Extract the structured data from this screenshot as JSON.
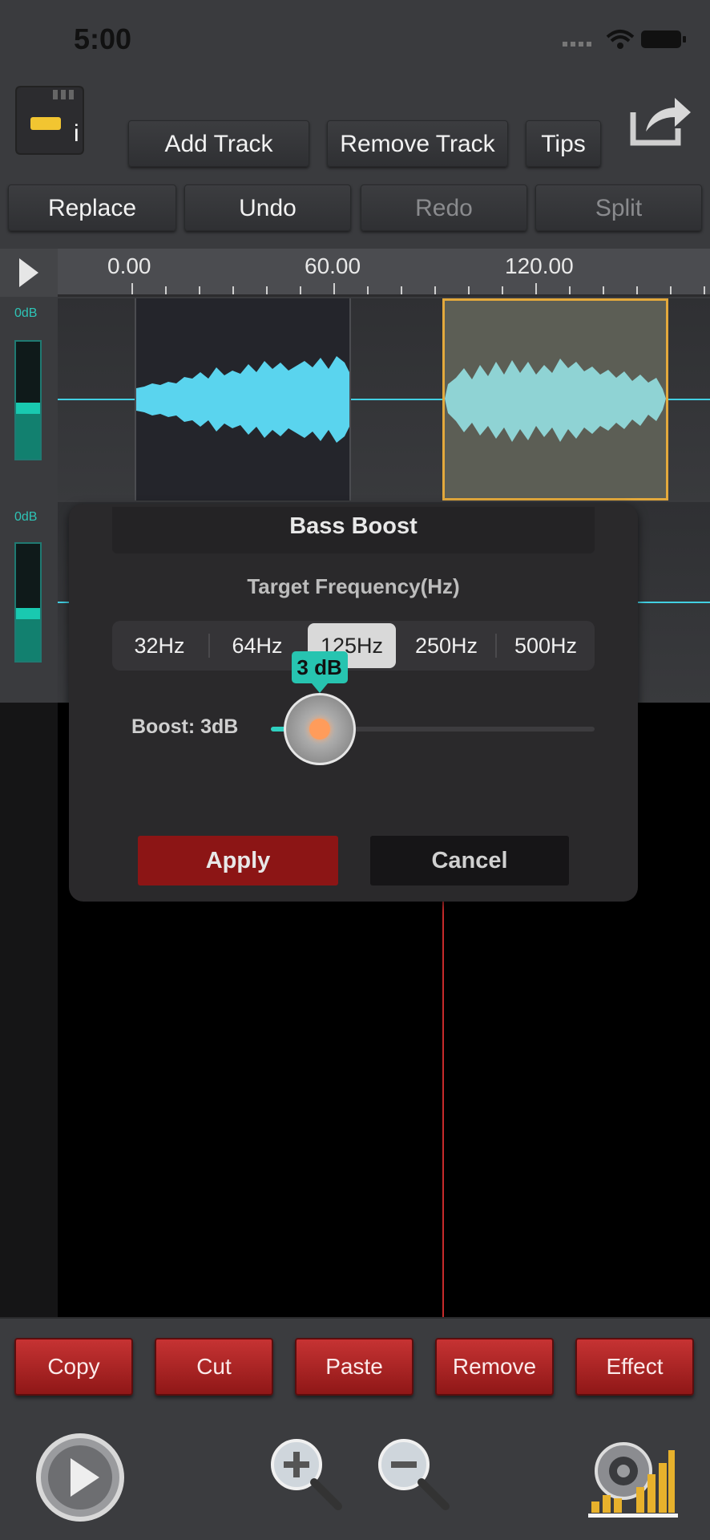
{
  "status": {
    "time": "5:00"
  },
  "toolbar_top": {
    "sd_badge": "i",
    "add_track": "Add Track",
    "remove_track": "Remove Track",
    "tips": "Tips"
  },
  "toolbar_edit": {
    "replace": "Replace",
    "undo": "Undo",
    "redo": "Redo",
    "split": "Split"
  },
  "ruler": {
    "labels": [
      "0.00",
      "60.00",
      "120.00"
    ]
  },
  "tracks": [
    {
      "db_label": "0dB",
      "level": 0.48
    },
    {
      "db_label": "0dB",
      "level": 0.45
    }
  ],
  "dialog": {
    "title": "Bass Boost",
    "freq_title": "Target Frequency(Hz)",
    "frequencies": [
      "32Hz",
      "64Hz",
      "125Hz",
      "250Hz",
      "500Hz"
    ],
    "selected_frequency": "125Hz",
    "boost_label": "Boost: 3dB",
    "bubble": "3 dB",
    "boost_fraction": 0.15,
    "apply": "Apply",
    "cancel": "Cancel"
  },
  "actions": {
    "copy": "Copy",
    "cut": "Cut",
    "paste": "Paste",
    "remove": "Remove",
    "effect": "Effect"
  },
  "icons": {
    "sd_card": "sd-card-icon",
    "share": "share-icon",
    "play_small": "play-icon",
    "play_large": "play-button-icon",
    "zoom_in": "zoom-in-icon",
    "zoom_out": "zoom-out-icon",
    "speaker": "speaker-levels-icon"
  },
  "colors": {
    "accent_teal": "#2fd0c0",
    "wave_blue": "#5ad4ee",
    "wave_selected": "#8fd3d4",
    "selection_border": "#e3a93c",
    "action_red": "#c63333",
    "playhead": "#c62b2b"
  }
}
